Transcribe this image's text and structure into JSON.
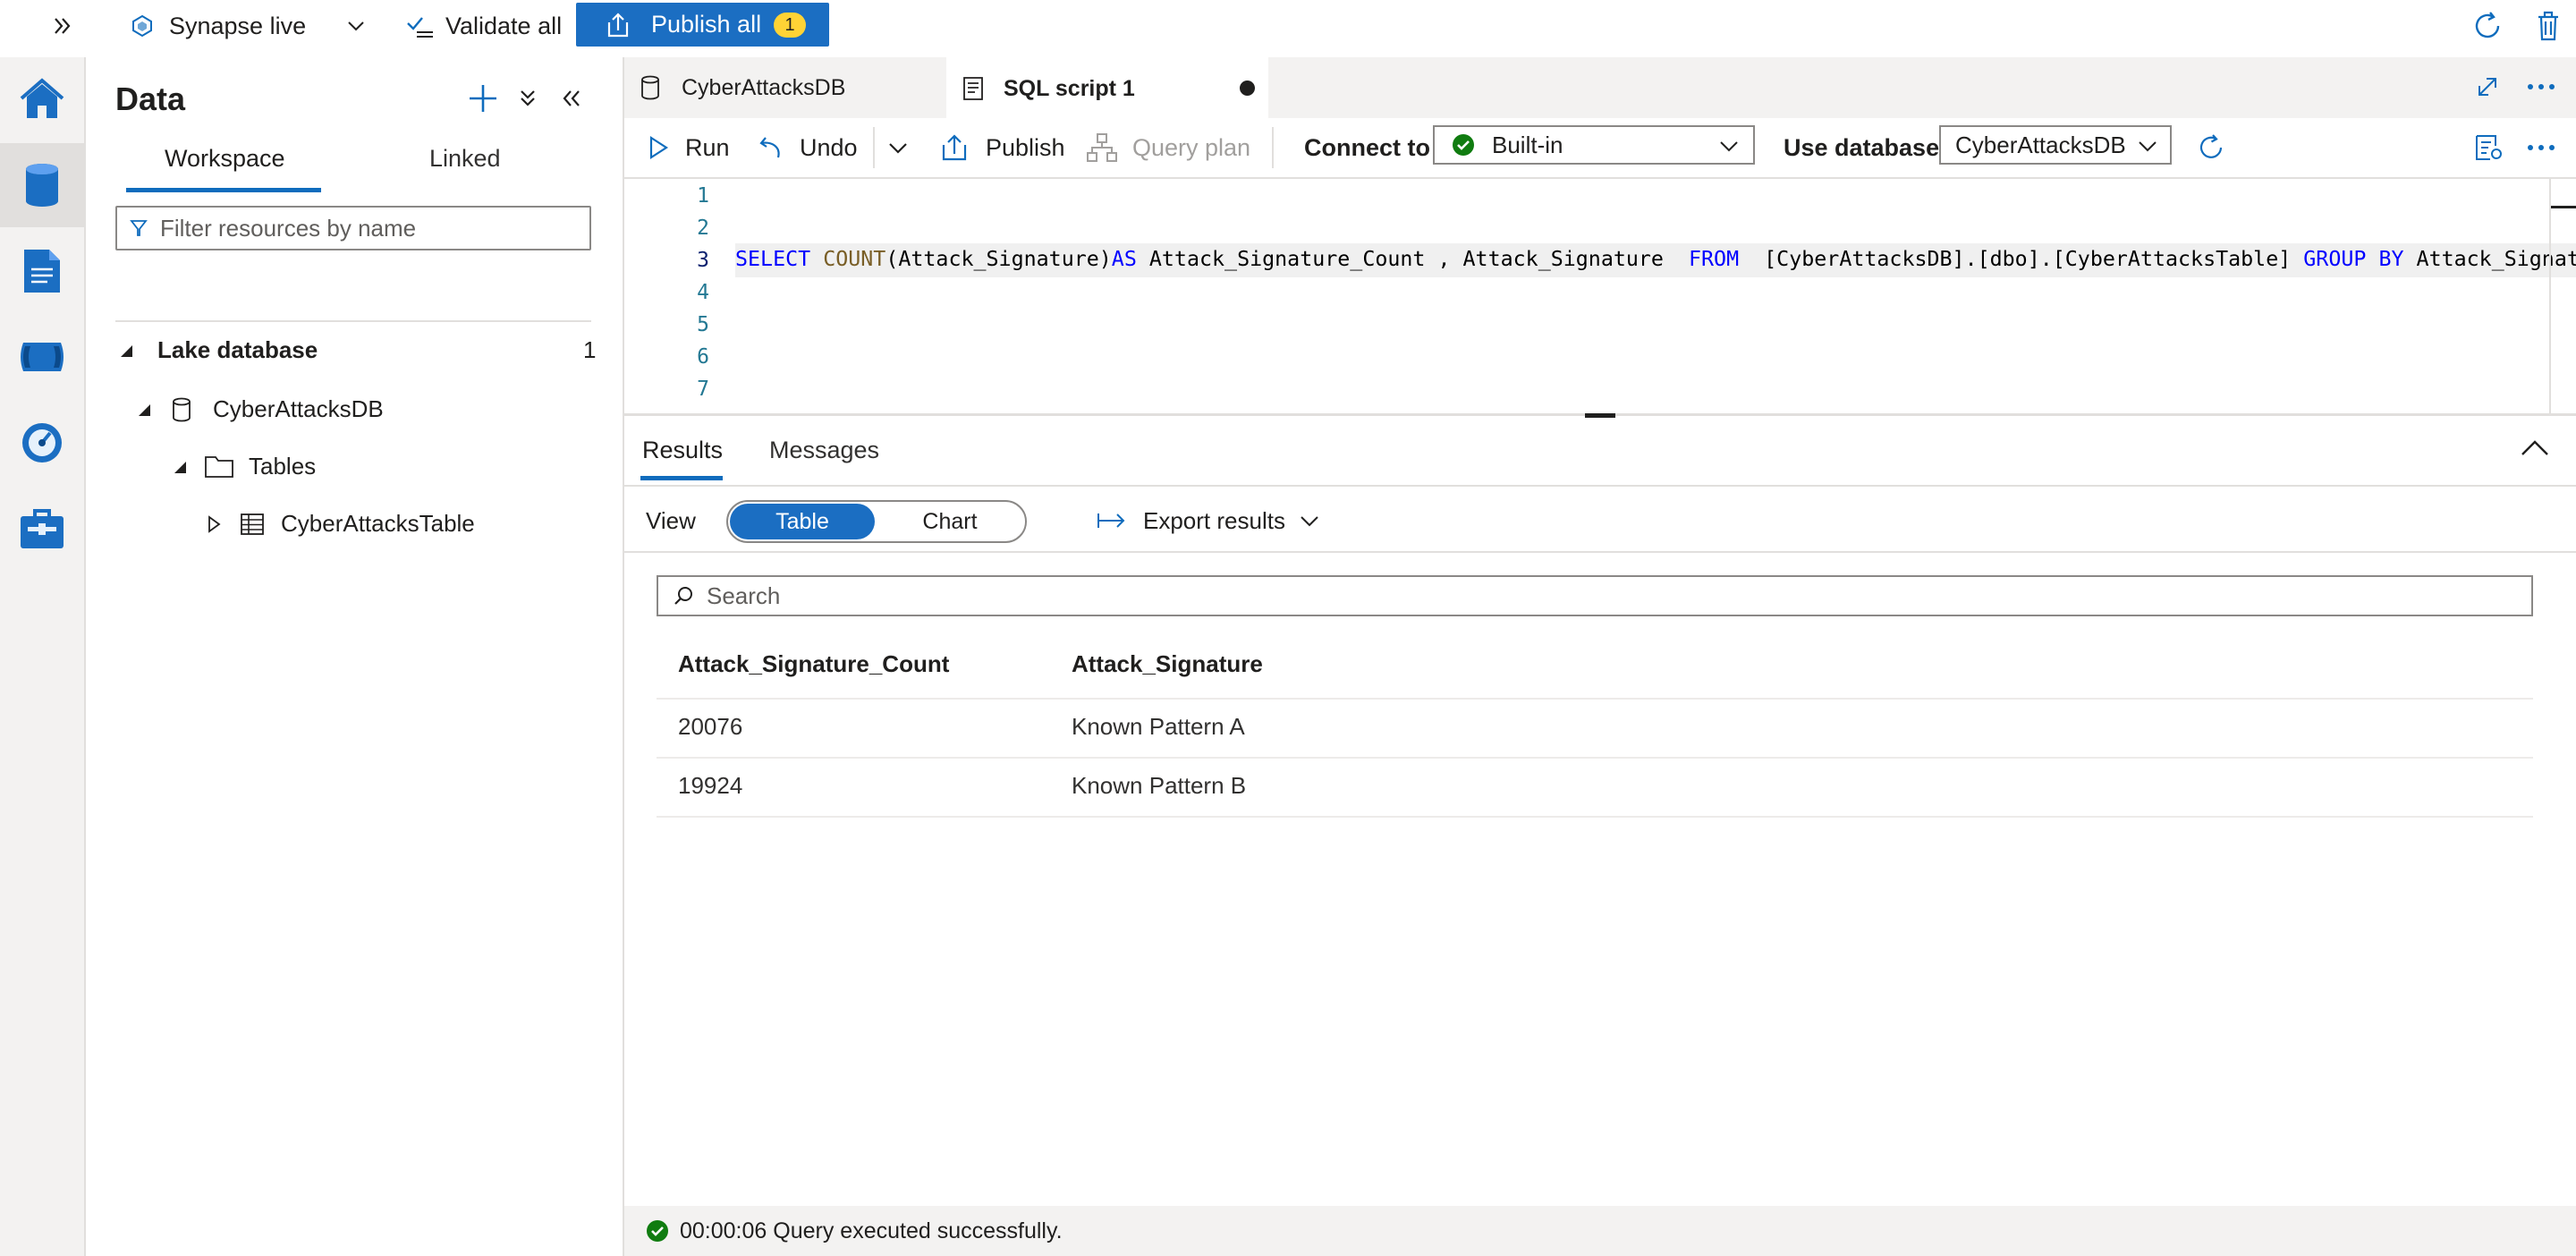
{
  "topbar": {
    "workspace_label": "Synapse live",
    "validate_label": "Validate all",
    "publish_label": "Publish all",
    "publish_count": "1"
  },
  "rail": {
    "items": [
      "home-icon",
      "data-icon",
      "develop-icon",
      "integrate-icon",
      "monitor-icon",
      "manage-icon"
    ],
    "active_item": "data-icon"
  },
  "data_pane": {
    "title": "Data",
    "tabs": [
      {
        "label": "Workspace",
        "active": true
      },
      {
        "label": "Linked",
        "active": false
      }
    ],
    "filter_placeholder": "Filter resources by name",
    "section_label": "Lake database",
    "section_count": "1",
    "tree": {
      "database": "CyberAttacksDB",
      "folder": "Tables",
      "table": "CyberAttacksTable"
    }
  },
  "doc_tabs": [
    {
      "label": "CyberAttacksDB",
      "active": false
    },
    {
      "label": "SQL script 1",
      "active": true,
      "unsaved": true
    }
  ],
  "toolbar": {
    "run_label": "Run",
    "undo_label": "Undo",
    "publish_label": "Publish",
    "query_plan_label": "Query plan",
    "connect_to_label": "Connect to",
    "connect_to_value": "Built-in",
    "use_database_label": "Use database",
    "use_database_value": "CyberAttacksDB"
  },
  "editor": {
    "line_numbers": [
      "1",
      "2",
      "3",
      "4",
      "5",
      "6",
      "7"
    ],
    "code_line": "SELECT COUNT(Attack_Signature)AS Attack_Signature_Count , Attack_Signature  FROM  [CyberAttacksDB].[dbo].[CyberAttacksTable] GROUP BY Attack_Signature",
    "code_line_number": 3
  },
  "results": {
    "tabs": [
      {
        "label": "Results",
        "active": true
      },
      {
        "label": "Messages",
        "active": false
      }
    ],
    "view_label": "View",
    "view_options": [
      "Table",
      "Chart"
    ],
    "view_selected": "Table",
    "export_label": "Export results",
    "search_placeholder": "Search",
    "columns": [
      "Attack_Signature_Count",
      "Attack_Signature"
    ],
    "rows": [
      [
        "20076",
        "Known Pattern A"
      ],
      [
        "19924",
        "Known Pattern B"
      ]
    ]
  },
  "status": {
    "text": "00:00:06 Query executed successfully."
  },
  "colors": {
    "accent": "#1b6ec2",
    "badge": "#ffd335",
    "success": "#107c10",
    "keyword": "#0000ff",
    "function": "#795e26"
  }
}
